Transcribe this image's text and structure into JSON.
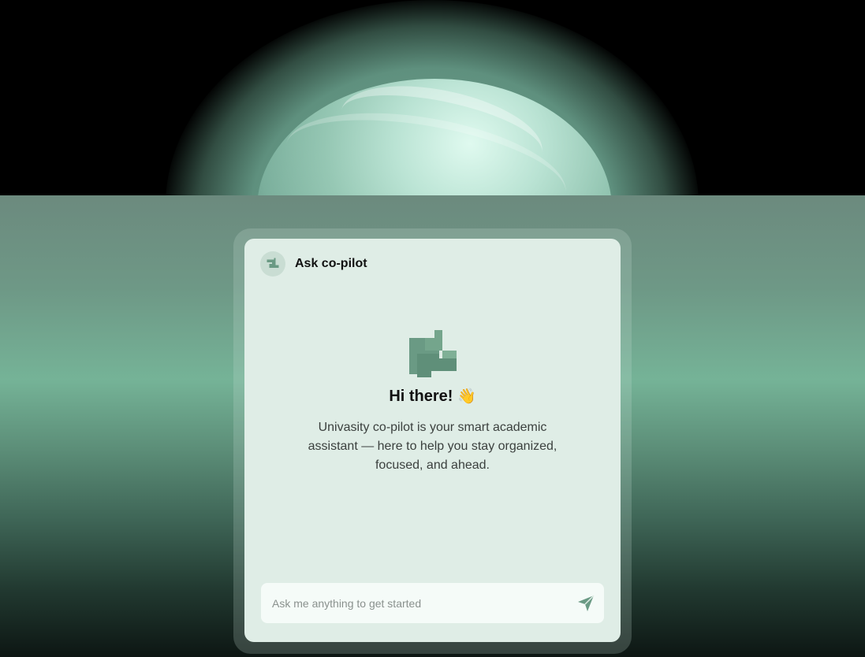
{
  "header": {
    "title": "Ask co-pilot",
    "avatar_icon": "copilot-logo-icon"
  },
  "hero": {
    "logo_icon": "copilot-logo-icon",
    "greeting": "Hi there!",
    "greeting_emoji": "👋",
    "intro": "Univasity co-pilot is your smart academic assistant — here to help you stay organized, focused, and ahead."
  },
  "composer": {
    "placeholder": "Ask me anything to get started",
    "value": "",
    "send_icon": "send-icon"
  },
  "colors": {
    "accent": "#6a9a84",
    "card_bg": "#dfede6",
    "input_bg": "#f5fbf8"
  }
}
